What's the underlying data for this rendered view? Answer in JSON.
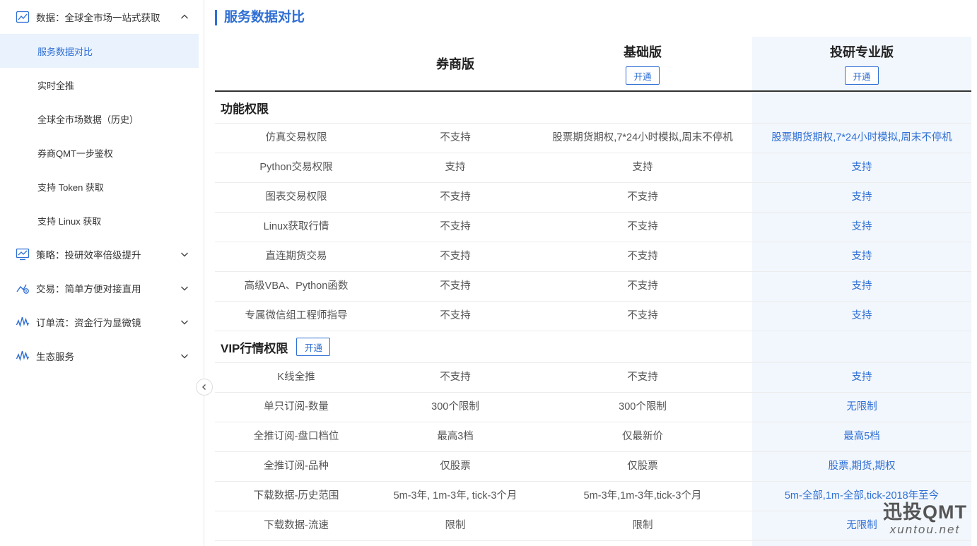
{
  "sidebar": {
    "groups": [
      {
        "label": "数据：全球全市场一站式获取",
        "icon": "chart-icon",
        "expanded": true,
        "items": [
          {
            "label": "服务数据对比",
            "active": true
          },
          {
            "label": "实时全推"
          },
          {
            "label": "全球全市场数据（历史）"
          },
          {
            "label": "券商QMT一步鉴权"
          },
          {
            "label": "支持 Token 获取"
          },
          {
            "label": "支持 Linux 获取"
          }
        ]
      },
      {
        "label": "策略：投研效率倍级提升",
        "icon": "monitor-chart-icon"
      },
      {
        "label": "交易：简单方便对接直用",
        "icon": "trend-icon"
      },
      {
        "label": "订单流：资金行为显微镜",
        "icon": "wave-icon"
      },
      {
        "label": "生态服务",
        "icon": "wave-icon"
      }
    ]
  },
  "page": {
    "title": "服务数据对比",
    "columns": [
      {
        "name": "券商版",
        "button": null
      },
      {
        "name": "基础版",
        "button": "开通"
      },
      {
        "name": "投研专业版",
        "button": "开通"
      }
    ],
    "sections": [
      {
        "title": "功能权限",
        "button": null,
        "rows": [
          [
            "仿真交易权限",
            "不支持",
            "股票期货期权,7*24小时模拟,周末不停机",
            "股票期货期权,7*24小时模拟,周末不停机"
          ],
          [
            "Python交易权限",
            "支持",
            "支持",
            "支持"
          ],
          [
            "图表交易权限",
            "不支持",
            "不支持",
            "支持"
          ],
          [
            "Linux获取行情",
            "不支持",
            "不支持",
            "支持"
          ],
          [
            "直连期货交易",
            "不支持",
            "不支持",
            "支持"
          ],
          [
            "高级VBA、Python函数",
            "不支持",
            "不支持",
            "支持"
          ],
          [
            "专属微信组工程师指导",
            "不支持",
            "不支持",
            "支持"
          ]
        ]
      },
      {
        "title": "VIP行情权限",
        "button": "开通",
        "rows": [
          [
            "K线全推",
            "不支持",
            "不支持",
            "支持"
          ],
          [
            "单只订阅-数量",
            "300个限制",
            "300个限制",
            "无限制"
          ],
          [
            "全推订阅-盘口档位",
            "最高3档",
            "仅最新价",
            "最高5档"
          ],
          [
            "全推订阅-品种",
            "仅股票",
            "仅股票",
            "股票,期货,期权"
          ],
          [
            "下载数据-历史范围",
            "5m-3年, 1m-3年, tick-3个月",
            "5m-3年,1m-3年,tick-3个月",
            "5m-全部,1m-全部,tick-2018年至今"
          ],
          [
            "下载数据-流速",
            "限制",
            "限制",
            "无限制"
          ]
        ]
      }
    ]
  },
  "watermark": {
    "brand": "迅投QMT",
    "domain": "xuntou.net"
  },
  "colors": {
    "accent": "#2f6fd4",
    "active_bg": "#e9f2fd",
    "pro_bg": "#f2f7fd"
  }
}
